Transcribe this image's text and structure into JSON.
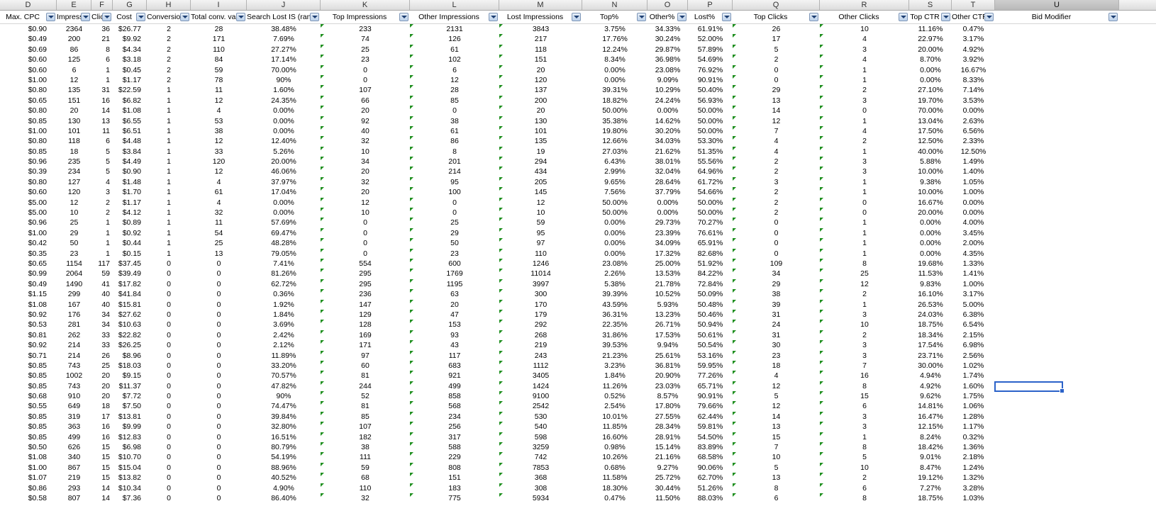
{
  "column_letters": [
    "D",
    "E",
    "F",
    "G",
    "H",
    "I",
    "J",
    "K",
    "L",
    "M",
    "N",
    "O",
    "P",
    "Q",
    "R",
    "S",
    "T",
    "U"
  ],
  "selected_column": "U",
  "header_labels": [
    "Max. CPC",
    "Impressio",
    "Clic",
    "Cost",
    "Conversio",
    "Total conv. val",
    "Search Lost IS (ran",
    "Top Impressions",
    "Other Impressions",
    "Lost Impressions",
    "Top%",
    "Other%",
    "Lost%",
    "Top Clicks",
    "Other Clicks",
    "Top CTR",
    "Other CTR",
    "Bid Modifier"
  ],
  "rows": [
    [
      "$0.90",
      "2364",
      "36",
      "$26.77",
      "2",
      "28",
      "38.48%",
      "233",
      "2131",
      "3843",
      "3.75%",
      "34.33%",
      "61.91%",
      "26",
      "10",
      "11.16%",
      "0.47%",
      ""
    ],
    [
      "$0.49",
      "200",
      "21",
      "$9.92",
      "2",
      "171",
      "7.69%",
      "74",
      "126",
      "217",
      "17.76%",
      "30.24%",
      "52.00%",
      "17",
      "4",
      "22.97%",
      "3.17%",
      ""
    ],
    [
      "$0.69",
      "86",
      "8",
      "$4.34",
      "2",
      "110",
      "27.27%",
      "25",
      "61",
      "118",
      "12.24%",
      "29.87%",
      "57.89%",
      "5",
      "3",
      "20.00%",
      "4.92%",
      ""
    ],
    [
      "$0.60",
      "125",
      "6",
      "$3.18",
      "2",
      "84",
      "17.14%",
      "23",
      "102",
      "151",
      "8.34%",
      "36.98%",
      "54.69%",
      "2",
      "4",
      "8.70%",
      "3.92%",
      ""
    ],
    [
      "$0.60",
      "6",
      "1",
      "$0.45",
      "2",
      "59",
      "70.00%",
      "0",
      "6",
      "20",
      "0.00%",
      "23.08%",
      "76.92%",
      "0",
      "1",
      "0.00%",
      "16.67%",
      ""
    ],
    [
      "$1.00",
      "12",
      "1",
      "$1.17",
      "2",
      "78",
      "90%",
      "0",
      "12",
      "120",
      "0.00%",
      "9.09%",
      "90.91%",
      "0",
      "1",
      "0.00%",
      "8.33%",
      ""
    ],
    [
      "$0.80",
      "135",
      "31",
      "$22.59",
      "1",
      "11",
      "1.60%",
      "107",
      "28",
      "137",
      "39.31%",
      "10.29%",
      "50.40%",
      "29",
      "2",
      "27.10%",
      "7.14%",
      ""
    ],
    [
      "$0.65",
      "151",
      "16",
      "$6.82",
      "1",
      "12",
      "24.35%",
      "66",
      "85",
      "200",
      "18.82%",
      "24.24%",
      "56.93%",
      "13",
      "3",
      "19.70%",
      "3.53%",
      ""
    ],
    [
      "$0.80",
      "20",
      "14",
      "$1.08",
      "1",
      "4",
      "0.00%",
      "20",
      "0",
      "20",
      "50.00%",
      "0.00%",
      "50.00%",
      "14",
      "0",
      "70.00%",
      "0.00%",
      ""
    ],
    [
      "$0.85",
      "130",
      "13",
      "$6.55",
      "1",
      "53",
      "0.00%",
      "92",
      "38",
      "130",
      "35.38%",
      "14.62%",
      "50.00%",
      "12",
      "1",
      "13.04%",
      "2.63%",
      ""
    ],
    [
      "$1.00",
      "101",
      "11",
      "$6.51",
      "1",
      "38",
      "0.00%",
      "40",
      "61",
      "101",
      "19.80%",
      "30.20%",
      "50.00%",
      "7",
      "4",
      "17.50%",
      "6.56%",
      ""
    ],
    [
      "$0.80",
      "118",
      "6",
      "$4.48",
      "1",
      "12",
      "12.40%",
      "32",
      "86",
      "135",
      "12.66%",
      "34.03%",
      "53.30%",
      "4",
      "2",
      "12.50%",
      "2.33%",
      ""
    ],
    [
      "$0.85",
      "18",
      "5",
      "$3.84",
      "1",
      "33",
      "5.26%",
      "10",
      "8",
      "19",
      "27.03%",
      "21.62%",
      "51.35%",
      "4",
      "1",
      "40.00%",
      "12.50%",
      ""
    ],
    [
      "$0.96",
      "235",
      "5",
      "$4.49",
      "1",
      "120",
      "20.00%",
      "34",
      "201",
      "294",
      "6.43%",
      "38.01%",
      "55.56%",
      "2",
      "3",
      "5.88%",
      "1.49%",
      ""
    ],
    [
      "$0.39",
      "234",
      "5",
      "$0.90",
      "1",
      "12",
      "46.06%",
      "20",
      "214",
      "434",
      "2.99%",
      "32.04%",
      "64.96%",
      "2",
      "3",
      "10.00%",
      "1.40%",
      ""
    ],
    [
      "$0.80",
      "127",
      "4",
      "$1.48",
      "1",
      "4",
      "37.97%",
      "32",
      "95",
      "205",
      "9.65%",
      "28.64%",
      "61.72%",
      "3",
      "1",
      "9.38%",
      "1.05%",
      ""
    ],
    [
      "$0.60",
      "120",
      "3",
      "$1.70",
      "1",
      "61",
      "17.04%",
      "20",
      "100",
      "145",
      "7.56%",
      "37.79%",
      "54.66%",
      "2",
      "1",
      "10.00%",
      "1.00%",
      ""
    ],
    [
      "$5.00",
      "12",
      "2",
      "$1.17",
      "1",
      "4",
      "0.00%",
      "12",
      "0",
      "12",
      "50.00%",
      "0.00%",
      "50.00%",
      "2",
      "0",
      "16.67%",
      "0.00%",
      ""
    ],
    [
      "$5.00",
      "10",
      "2",
      "$4.12",
      "1",
      "32",
      "0.00%",
      "10",
      "0",
      "10",
      "50.00%",
      "0.00%",
      "50.00%",
      "2",
      "0",
      "20.00%",
      "0.00%",
      ""
    ],
    [
      "$0.96",
      "25",
      "1",
      "$0.89",
      "1",
      "11",
      "57.69%",
      "0",
      "25",
      "59",
      "0.00%",
      "29.73%",
      "70.27%",
      "0",
      "1",
      "0.00%",
      "4.00%",
      ""
    ],
    [
      "$1.00",
      "29",
      "1",
      "$0.92",
      "1",
      "54",
      "69.47%",
      "0",
      "29",
      "95",
      "0.00%",
      "23.39%",
      "76.61%",
      "0",
      "1",
      "0.00%",
      "3.45%",
      ""
    ],
    [
      "$0.42",
      "50",
      "1",
      "$0.44",
      "1",
      "25",
      "48.28%",
      "0",
      "50",
      "97",
      "0.00%",
      "34.09%",
      "65.91%",
      "0",
      "1",
      "0.00%",
      "2.00%",
      ""
    ],
    [
      "$0.35",
      "23",
      "1",
      "$0.15",
      "1",
      "13",
      "79.05%",
      "0",
      "23",
      "110",
      "0.00%",
      "17.32%",
      "82.68%",
      "0",
      "1",
      "0.00%",
      "4.35%",
      ""
    ],
    [
      "$0.65",
      "1154",
      "117",
      "$37.45",
      "0",
      "0",
      "7.41%",
      "554",
      "600",
      "1246",
      "23.08%",
      "25.00%",
      "51.92%",
      "109",
      "8",
      "19.68%",
      "1.33%",
      ""
    ],
    [
      "$0.99",
      "2064",
      "59",
      "$39.49",
      "0",
      "0",
      "81.26%",
      "295",
      "1769",
      "11014",
      "2.26%",
      "13.53%",
      "84.22%",
      "34",
      "25",
      "11.53%",
      "1.41%",
      ""
    ],
    [
      "$0.49",
      "1490",
      "41",
      "$17.82",
      "0",
      "0",
      "62.72%",
      "295",
      "1195",
      "3997",
      "5.38%",
      "21.78%",
      "72.84%",
      "29",
      "12",
      "9.83%",
      "1.00%",
      ""
    ],
    [
      "$1.15",
      "299",
      "40",
      "$41.84",
      "0",
      "0",
      "0.36%",
      "236",
      "63",
      "300",
      "39.39%",
      "10.52%",
      "50.09%",
      "38",
      "2",
      "16.10%",
      "3.17%",
      ""
    ],
    [
      "$1.08",
      "167",
      "40",
      "$15.81",
      "0",
      "0",
      "1.92%",
      "147",
      "20",
      "170",
      "43.59%",
      "5.93%",
      "50.48%",
      "39",
      "1",
      "26.53%",
      "5.00%",
      ""
    ],
    [
      "$0.92",
      "176",
      "34",
      "$27.62",
      "0",
      "0",
      "1.84%",
      "129",
      "47",
      "179",
      "36.31%",
      "13.23%",
      "50.46%",
      "31",
      "3",
      "24.03%",
      "6.38%",
      ""
    ],
    [
      "$0.53",
      "281",
      "34",
      "$10.63",
      "0",
      "0",
      "3.69%",
      "128",
      "153",
      "292",
      "22.35%",
      "26.71%",
      "50.94%",
      "24",
      "10",
      "18.75%",
      "6.54%",
      ""
    ],
    [
      "$0.81",
      "262",
      "33",
      "$22.82",
      "0",
      "0",
      "2.42%",
      "169",
      "93",
      "268",
      "31.86%",
      "17.53%",
      "50.61%",
      "31",
      "2",
      "18.34%",
      "2.15%",
      ""
    ],
    [
      "$0.92",
      "214",
      "33",
      "$26.25",
      "0",
      "0",
      "2.12%",
      "171",
      "43",
      "219",
      "39.53%",
      "9.94%",
      "50.54%",
      "30",
      "3",
      "17.54%",
      "6.98%",
      ""
    ],
    [
      "$0.71",
      "214",
      "26",
      "$8.96",
      "0",
      "0",
      "11.89%",
      "97",
      "117",
      "243",
      "21.23%",
      "25.61%",
      "53.16%",
      "23",
      "3",
      "23.71%",
      "2.56%",
      ""
    ],
    [
      "$0.85",
      "743",
      "25",
      "$18.03",
      "0",
      "0",
      "33.20%",
      "60",
      "683",
      "1112",
      "3.23%",
      "36.81%",
      "59.95%",
      "18",
      "7",
      "30.00%",
      "1.02%",
      ""
    ],
    [
      "$0.85",
      "1002",
      "20",
      "$9.15",
      "0",
      "0",
      "70.57%",
      "81",
      "921",
      "3405",
      "1.84%",
      "20.90%",
      "77.26%",
      "4",
      "16",
      "4.94%",
      "1.74%",
      ""
    ],
    [
      "$0.85",
      "743",
      "20",
      "$11.37",
      "0",
      "0",
      "47.82%",
      "244",
      "499",
      "1424",
      "11.26%",
      "23.03%",
      "65.71%",
      "12",
      "8",
      "4.92%",
      "1.60%",
      ""
    ],
    [
      "$0.68",
      "910",
      "20",
      "$7.72",
      "0",
      "0",
      "90%",
      "52",
      "858",
      "9100",
      "0.52%",
      "8.57%",
      "90.91%",
      "5",
      "15",
      "9.62%",
      "1.75%",
      ""
    ],
    [
      "$0.55",
      "649",
      "18",
      "$7.50",
      "0",
      "0",
      "74.47%",
      "81",
      "568",
      "2542",
      "2.54%",
      "17.80%",
      "79.66%",
      "12",
      "6",
      "14.81%",
      "1.06%",
      ""
    ],
    [
      "$0.85",
      "319",
      "17",
      "$13.81",
      "0",
      "0",
      "39.84%",
      "85",
      "234",
      "530",
      "10.01%",
      "27.55%",
      "62.44%",
      "14",
      "3",
      "16.47%",
      "1.28%",
      ""
    ],
    [
      "$0.85",
      "363",
      "16",
      "$9.99",
      "0",
      "0",
      "32.80%",
      "107",
      "256",
      "540",
      "11.85%",
      "28.34%",
      "59.81%",
      "13",
      "3",
      "12.15%",
      "1.17%",
      ""
    ],
    [
      "$0.85",
      "499",
      "16",
      "$12.83",
      "0",
      "0",
      "16.51%",
      "182",
      "317",
      "598",
      "16.60%",
      "28.91%",
      "54.50%",
      "15",
      "1",
      "8.24%",
      "0.32%",
      ""
    ],
    [
      "$0.50",
      "626",
      "15",
      "$6.98",
      "0",
      "0",
      "80.79%",
      "38",
      "588",
      "3259",
      "0.98%",
      "15.14%",
      "83.89%",
      "7",
      "8",
      "18.42%",
      "1.36%",
      ""
    ],
    [
      "$1.08",
      "340",
      "15",
      "$10.70",
      "0",
      "0",
      "54.19%",
      "111",
      "229",
      "742",
      "10.26%",
      "21.16%",
      "68.58%",
      "10",
      "5",
      "9.01%",
      "2.18%",
      ""
    ],
    [
      "$1.00",
      "867",
      "15",
      "$15.04",
      "0",
      "0",
      "88.96%",
      "59",
      "808",
      "7853",
      "0.68%",
      "9.27%",
      "90.06%",
      "5",
      "10",
      "8.47%",
      "1.24%",
      ""
    ],
    [
      "$1.07",
      "219",
      "15",
      "$13.82",
      "0",
      "0",
      "40.52%",
      "68",
      "151",
      "368",
      "11.58%",
      "25.72%",
      "62.70%",
      "13",
      "2",
      "19.12%",
      "1.32%",
      ""
    ],
    [
      "$0.86",
      "293",
      "14",
      "$10.34",
      "0",
      "0",
      "4.90%",
      "110",
      "183",
      "308",
      "18.30%",
      "30.44%",
      "51.26%",
      "8",
      "6",
      "7.27%",
      "3.28%",
      ""
    ],
    [
      "$0.58",
      "807",
      "14",
      "$7.36",
      "0",
      "0",
      "86.40%",
      "32",
      "775",
      "5934",
      "0.47%",
      "11.50%",
      "88.03%",
      "6",
      "8",
      "18.75%",
      "1.03%",
      ""
    ]
  ]
}
